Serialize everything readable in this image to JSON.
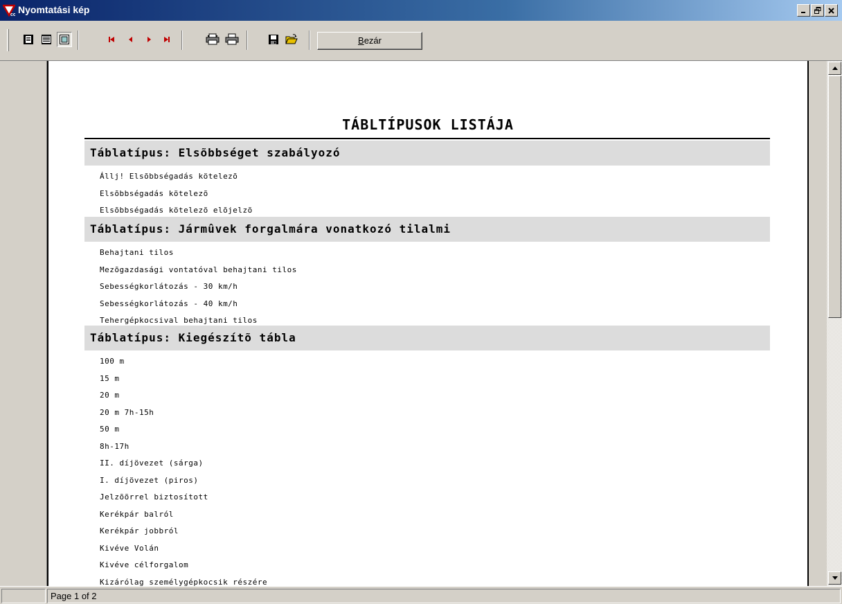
{
  "window": {
    "title": "Nyomtatási kép",
    "controls": [
      "minimize",
      "maximize",
      "close"
    ]
  },
  "toolbar": {
    "buttons": [
      {
        "name": "whole-page-icon",
        "pressed": false
      },
      {
        "name": "page-width-icon",
        "pressed": false
      },
      {
        "name": "hundred-percent-icon",
        "pressed": true
      },
      {
        "name": "first-page-icon"
      },
      {
        "name": "prev-page-icon"
      },
      {
        "name": "next-page-icon"
      },
      {
        "name": "last-page-icon"
      },
      {
        "name": "printer-setup-icon"
      },
      {
        "name": "print-icon"
      },
      {
        "name": "save-icon"
      },
      {
        "name": "open-icon"
      }
    ],
    "close_label_first": "B",
    "close_label_rest": "ezár",
    "accent_color": "#c00000"
  },
  "report": {
    "title": "TÁBLTÍPUSOK LISTÁJA",
    "groups": [
      {
        "header": "Táblatípus: Elsõbbséget szabályozó",
        "items": [
          "Állj! Elsõbbségadás kötelezõ",
          "Elsõbbségadás kötelezõ",
          "Elsõbbségadás kötelezõ elõjelzõ"
        ]
      },
      {
        "header": "Táblatípus: Jármûvek forgalmára vonatkozó tilalmi",
        "items": [
          "Behajtani tilos",
          "Mezõgazdasági vontatóval behajtani tilos",
          "Sebességkorlátozás - 30 km/h",
          "Sebességkorlátozás - 40 km/h",
          "Tehergépkocsival behajtani tilos"
        ]
      },
      {
        "header": "Táblatípus: Kiegészítõ tábla",
        "items": [
          "100 m",
          "15 m",
          "20 m",
          "20 m 7h-15h",
          "50 m",
          "8h-17h",
          "II. díjövezet (sárga)",
          "I. díjövezet (piros)",
          "Jelzõõrrel biztosított",
          "Kerékpár balról",
          "Kerékpár jobbról",
          "Kivéve Volán",
          "Kivéve célforgalom",
          "Kizárólag személygépkocsik részére"
        ]
      }
    ]
  },
  "status": {
    "page_label": "Page 1 of 2"
  }
}
